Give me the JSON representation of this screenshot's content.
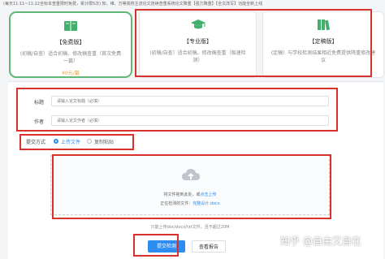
{
  "notice": "(每天11:11~11:22全标本查重限时免费，累计限5次) 知、维、万等高校主流论文连续查重系统论文降重【强力降重】【全文改写】功能全新上线",
  "cards": [
    {
      "icon": "book-icon",
      "title": "【免费版】",
      "desc": "(初稿/自查）适合初稿、修改稿查重（首次免费一篇）",
      "price": "¥0元/篇"
    },
    {
      "icon": "graduation-cap-icon",
      "title": "【专业版】",
      "desc": "(初稿/自查）适合初稿、修改稿查重（极速检测）"
    },
    {
      "icon": "books-icon",
      "title": "【定稿版】",
      "desc": "(定稿）与学校检测结果相近免费提供降重修改建议"
    }
  ],
  "form": {
    "title_label": "标题",
    "title_placeholder": "请输入论文标题（必填）",
    "author_label": "作者",
    "author_placeholder": "请输入论文作者（必填）",
    "method_label": "提交方式",
    "method_options": [
      "上传文件",
      "复制粘贴"
    ]
  },
  "upload": {
    "hint": "将文件拖到此处，或",
    "link": "点击上传",
    "file_prefix": "正在检测的文件：",
    "file_name": "完整设计.docx",
    "note": "只能上传doc/docx/txt文件，且不超过20M"
  },
  "buttons": {
    "submit": "提交检测",
    "report": "查看报告"
  },
  "watermark": "知乎 @自由又自在",
  "colors": {
    "accent": "#2d8cf0",
    "highlight": "#d9312b",
    "selected": "#5fb878",
    "price": "#e8a23a"
  }
}
